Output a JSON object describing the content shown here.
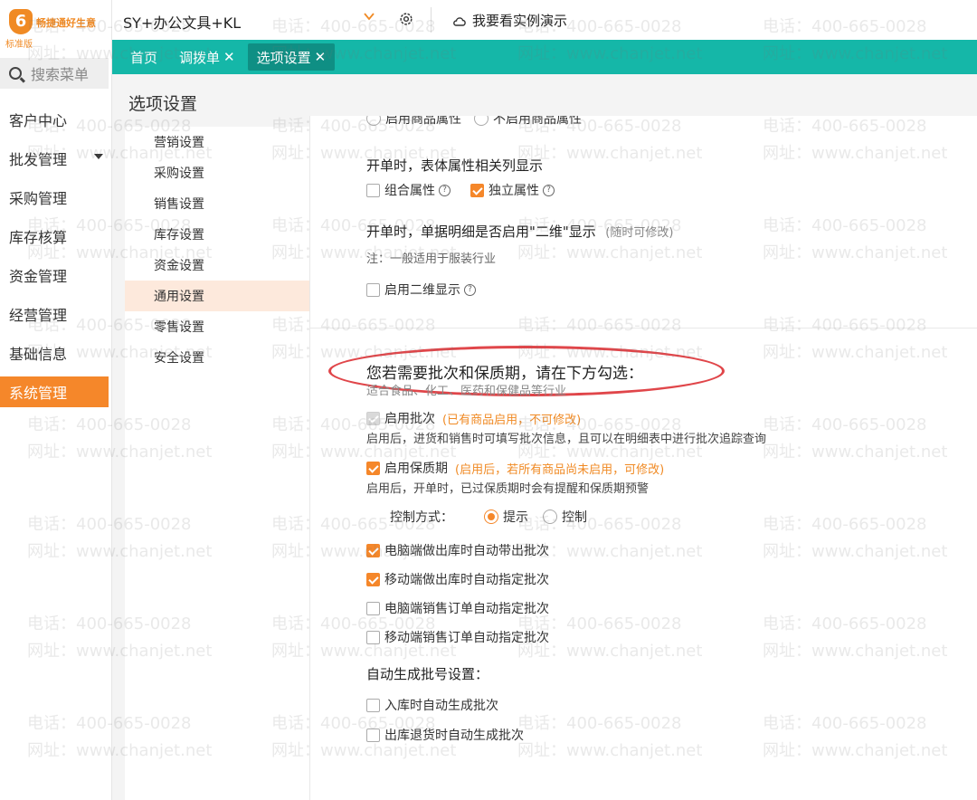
{
  "app": {
    "logo_mark": "6",
    "logo_text": "畅捷通好生意",
    "edition": "标准版",
    "search_placeholder": "搜索菜单",
    "company": "SY+办公文具+KL",
    "demo_label": "我要看实例演示"
  },
  "nav": {
    "items": [
      {
        "label": "客户中心"
      },
      {
        "label": "批发管理"
      },
      {
        "label": "采购管理"
      },
      {
        "label": "库存核算"
      },
      {
        "label": "资金管理"
      },
      {
        "label": "经营管理"
      },
      {
        "label": "基础信息"
      },
      {
        "label": "系统管理"
      }
    ],
    "active": "系统管理"
  },
  "tabs": [
    {
      "label": "首页",
      "closable": false
    },
    {
      "label": "调拨单",
      "closable": true
    },
    {
      "label": "选项设置",
      "closable": true,
      "active": true
    }
  ],
  "page": {
    "title": "选项设置",
    "settings_nav": [
      {
        "label": "营销设置"
      },
      {
        "label": "采购设置"
      },
      {
        "label": "销售设置"
      },
      {
        "label": "库存设置"
      },
      {
        "label": "资金设置"
      },
      {
        "label": "通用设置",
        "active": true
      },
      {
        "label": "零售设置"
      },
      {
        "label": "安全设置"
      }
    ]
  },
  "content": {
    "cut_top_left": "启用商品属性",
    "cut_top_right": "不启用商品属性",
    "attr_heading": "开单时，表体属性相关列显示",
    "attr_combo": "组合属性",
    "attr_independent": "独立属性",
    "twod_heading": "开单时，单据明细是否启用\"二维\"显示",
    "twod_hint": "(随时可修改)",
    "twod_note": "注：一般适用于服装行业",
    "twod_enable": "启用二维显示",
    "batch_heading": "您若需要批次和保质期，请在下方勾选：",
    "batch_subnote": "适合食品、化工、医药和保健品等行业",
    "batch_enable": "启用批次",
    "batch_enable_hint": "(已有商品启用，不可修改)",
    "batch_desc": "启用后，进货和销售时可填写批次信息，且可以在明细表中进行批次追踪查询",
    "shelf_enable": "启用保质期",
    "shelf_enable_hint": "(启用后，若所有商品尚未启用，可修改)",
    "shelf_desc": "启用后，开单时，已过保质期时会有提醒和保质期预警",
    "control_label": "控制方式：",
    "control_options": [
      "提示",
      "控制"
    ],
    "control_selected": "提示",
    "opt1": "电脑端做出库时自动带出批次",
    "opt2": "移动端做出库时自动指定批次",
    "opt3": "电脑端销售订单自动指定批次",
    "opt4": "移动端销售订单自动指定批次",
    "auto_heading": "自动生成批号设置：",
    "auto1": "入库时自动生成批次",
    "auto2": "出库退货时自动生成批次"
  },
  "watermark": {
    "phone": "电话：400-665-0028",
    "site": "网址：www.chanjet.net"
  },
  "colors": {
    "brand_orange": "#f5872a",
    "tab_teal": "#15b7a8",
    "annotation_red": "#e0464a"
  }
}
